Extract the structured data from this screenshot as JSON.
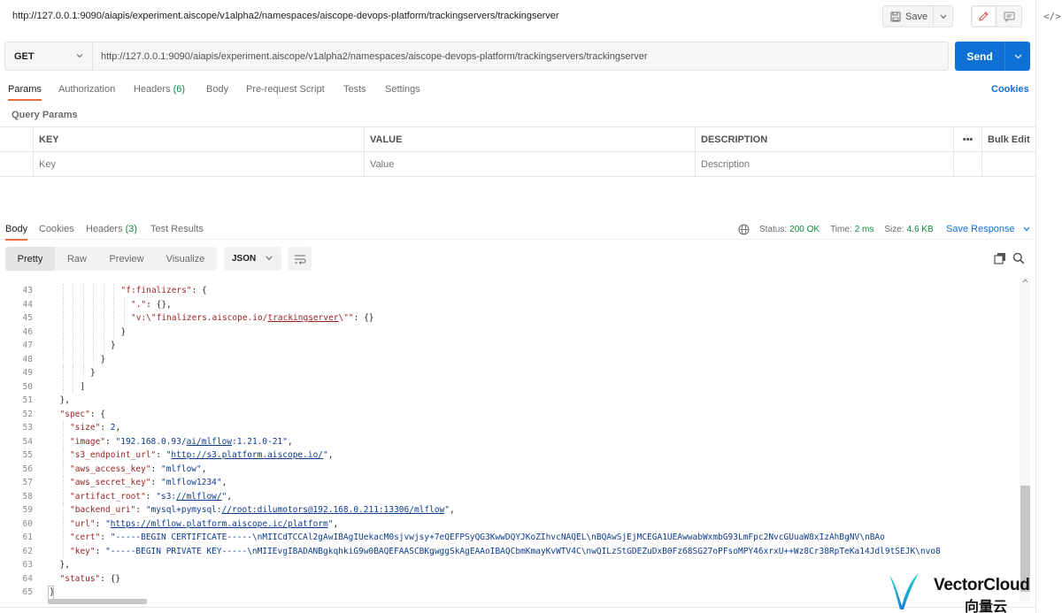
{
  "request": {
    "title": "http://127.0.0.1:9090/aiapis/experiment.aiscope/v1alpha2/namespaces/aiscope-devops-platform/trackingservers/trackingserver",
    "method": "GET",
    "url": "http://127.0.0.1:9090/aiapis/experiment.aiscope/v1alpha2/namespaces/aiscope-devops-platform/trackingservers/trackingserver"
  },
  "toolbar": {
    "save_label": "Save",
    "send_label": "Send"
  },
  "request_tabs": {
    "params": "Params",
    "authorization": "Authorization",
    "headers": "Headers",
    "headers_count": "(6)",
    "body": "Body",
    "prerequest": "Pre-request Script",
    "tests": "Tests",
    "settings": "Settings",
    "cookies": "Cookies"
  },
  "query_params": {
    "label": "Query Params",
    "headers": {
      "key": "KEY",
      "value": "VALUE",
      "description": "DESCRIPTION",
      "more": "•••",
      "bulk_edit": "Bulk Edit"
    },
    "placeholders": {
      "key": "Key",
      "value": "Value",
      "description": "Description"
    }
  },
  "response_tabs": {
    "body": "Body",
    "cookies": "Cookies",
    "headers": "Headers",
    "headers_count": "(3)",
    "test_results": "Test Results"
  },
  "response_meta": {
    "status_label": "Status:",
    "status_value": "200 OK",
    "time_label": "Time:",
    "time_value": "2 ms",
    "size_label": "Size:",
    "size_value": "4.6 KB",
    "save_response": "Save Response"
  },
  "view_modes": {
    "pretty": "Pretty",
    "raw": "Raw",
    "preview": "Preview",
    "visualize": "Visualize",
    "format": "JSON"
  },
  "code_lines": [
    {
      "n": "43",
      "indent": 14,
      "tokens": [
        [
          "k",
          "\"f:finalizers\""
        ],
        [
          "p",
          ": {"
        ]
      ]
    },
    {
      "n": "44",
      "indent": 16,
      "tokens": [
        [
          "k",
          "\".\""
        ],
        [
          "p",
          ": {},"
        ]
      ]
    },
    {
      "n": "45",
      "indent": 16,
      "tokens": [
        [
          "k",
          "\"v:\\\"finalizers.aiscope.io/"
        ],
        [
          "ku",
          "trackingserver"
        ],
        [
          "k",
          "\\\"\""
        ],
        [
          "p",
          ": {}"
        ]
      ]
    },
    {
      "n": "46",
      "indent": 14,
      "tokens": [
        [
          "p",
          "}"
        ]
      ]
    },
    {
      "n": "47",
      "indent": 12,
      "tokens": [
        [
          "p",
          "}"
        ]
      ]
    },
    {
      "n": "48",
      "indent": 10,
      "tokens": [
        [
          "p",
          "}"
        ]
      ]
    },
    {
      "n": "49",
      "indent": 8,
      "tokens": [
        [
          "p",
          "}"
        ]
      ]
    },
    {
      "n": "50",
      "indent": 6,
      "tokens": [
        [
          "p",
          "]"
        ]
      ]
    },
    {
      "n": "51",
      "indent": 2,
      "tokens": [
        [
          "p",
          "},"
        ]
      ]
    },
    {
      "n": "52",
      "indent": 2,
      "tokens": [
        [
          "k",
          "\"spec\""
        ],
        [
          "p",
          ": {"
        ]
      ]
    },
    {
      "n": "53",
      "indent": 4,
      "tokens": [
        [
          "k",
          "\"size\""
        ],
        [
          "p",
          ": "
        ],
        [
          "n",
          "2"
        ],
        [
          "p",
          ","
        ]
      ]
    },
    {
      "n": "54",
      "indent": 4,
      "tokens": [
        [
          "k",
          "\"image\""
        ],
        [
          "p",
          ": "
        ],
        [
          "s",
          "\"192.168.0.93/"
        ],
        [
          "su",
          "ai/mlflow"
        ],
        [
          "s",
          ":1.21.0-21\""
        ],
        [
          "p",
          ","
        ]
      ]
    },
    {
      "n": "55",
      "indent": 4,
      "tokens": [
        [
          "k",
          "\"s3_endpoint_url\""
        ],
        [
          "p",
          ": "
        ],
        [
          "s",
          "\""
        ],
        [
          "su",
          "http://s3.platform.aiscope.io/"
        ],
        [
          "s",
          "\""
        ],
        [
          "p",
          ","
        ]
      ]
    },
    {
      "n": "56",
      "indent": 4,
      "tokens": [
        [
          "k",
          "\"aws_access_key\""
        ],
        [
          "p",
          ": "
        ],
        [
          "s",
          "\"mlflow\""
        ],
        [
          "p",
          ","
        ]
      ]
    },
    {
      "n": "57",
      "indent": 4,
      "tokens": [
        [
          "k",
          "\"aws_secret_key\""
        ],
        [
          "p",
          ": "
        ],
        [
          "s",
          "\"mlflow1234\""
        ],
        [
          "p",
          ","
        ]
      ]
    },
    {
      "n": "58",
      "indent": 4,
      "tokens": [
        [
          "k",
          "\"artifact_root\""
        ],
        [
          "p",
          ": "
        ],
        [
          "s",
          "\"s3:"
        ],
        [
          "su",
          "//mlflow/"
        ],
        [
          "s",
          "\""
        ],
        [
          "p",
          ","
        ]
      ]
    },
    {
      "n": "59",
      "indent": 4,
      "tokens": [
        [
          "k",
          "\"backend_uri\""
        ],
        [
          "p",
          ": "
        ],
        [
          "s",
          "\"mysql+pymysql:"
        ],
        [
          "su",
          "//root:dilumotors@192.168.0.211:13306/mlflow"
        ],
        [
          "s",
          "\""
        ],
        [
          "p",
          ","
        ]
      ]
    },
    {
      "n": "60",
      "indent": 4,
      "tokens": [
        [
          "k",
          "\"url\""
        ],
        [
          "p",
          ": "
        ],
        [
          "s",
          "\""
        ],
        [
          "su",
          "https://mlflow.platform.aiscope.ic/platform"
        ],
        [
          "s",
          "\""
        ],
        [
          "p",
          ","
        ]
      ]
    },
    {
      "n": "61",
      "indent": 4,
      "tokens": [
        [
          "k",
          "\"cert\""
        ],
        [
          "p",
          ": "
        ],
        [
          "s",
          "\"-----BEGIN CERTIFICATE-----\\nMIICdTCCAl2gAwIBAgIUekacM0sjvwjsy+7eQEFPSyQG3KwwDQYJKoZIhvcNAQEL\\nBQAwSjEjMCEGA1UEAwwabWxmbG93LmFpc2NvcGUuaW8xIzAhBgNV\\nBAo"
        ]
      ]
    },
    {
      "n": "62",
      "indent": 4,
      "tokens": [
        [
          "k",
          "\"key\""
        ],
        [
          "p",
          ": "
        ],
        [
          "s",
          "\"-----BEGIN PRIVATE KEY-----\\nMIIEvgIBADANBgkqhkiG9w0BAQEFAASCBKgwggSkAgEAAoIBAQCbmKmayKvWTV4C\\nwQILzStGDEZuDxB0Fz68SG27oPFsoMPY46xrxU++Wz8Cr38RpTeKa14Jdl9tSEJK\\nvo8"
        ]
      ]
    },
    {
      "n": "63",
      "indent": 2,
      "tokens": [
        [
          "p",
          "},"
        ]
      ]
    },
    {
      "n": "64",
      "indent": 2,
      "tokens": [
        [
          "k",
          "\"status\""
        ],
        [
          "p",
          ": {}"
        ]
      ]
    },
    {
      "n": "65",
      "indent": 0,
      "tokens": [
        [
          "p",
          "}"
        ]
      ]
    }
  ],
  "watermark": {
    "text": "VectorCloud",
    "sub": "向量云"
  },
  "colors": {
    "accent": "#0f71d6",
    "active_tab": "#f26b3a",
    "status_ok": "#0c8a3c",
    "json_key": "#9b1e1e",
    "json_string": "#0b3b8f"
  }
}
